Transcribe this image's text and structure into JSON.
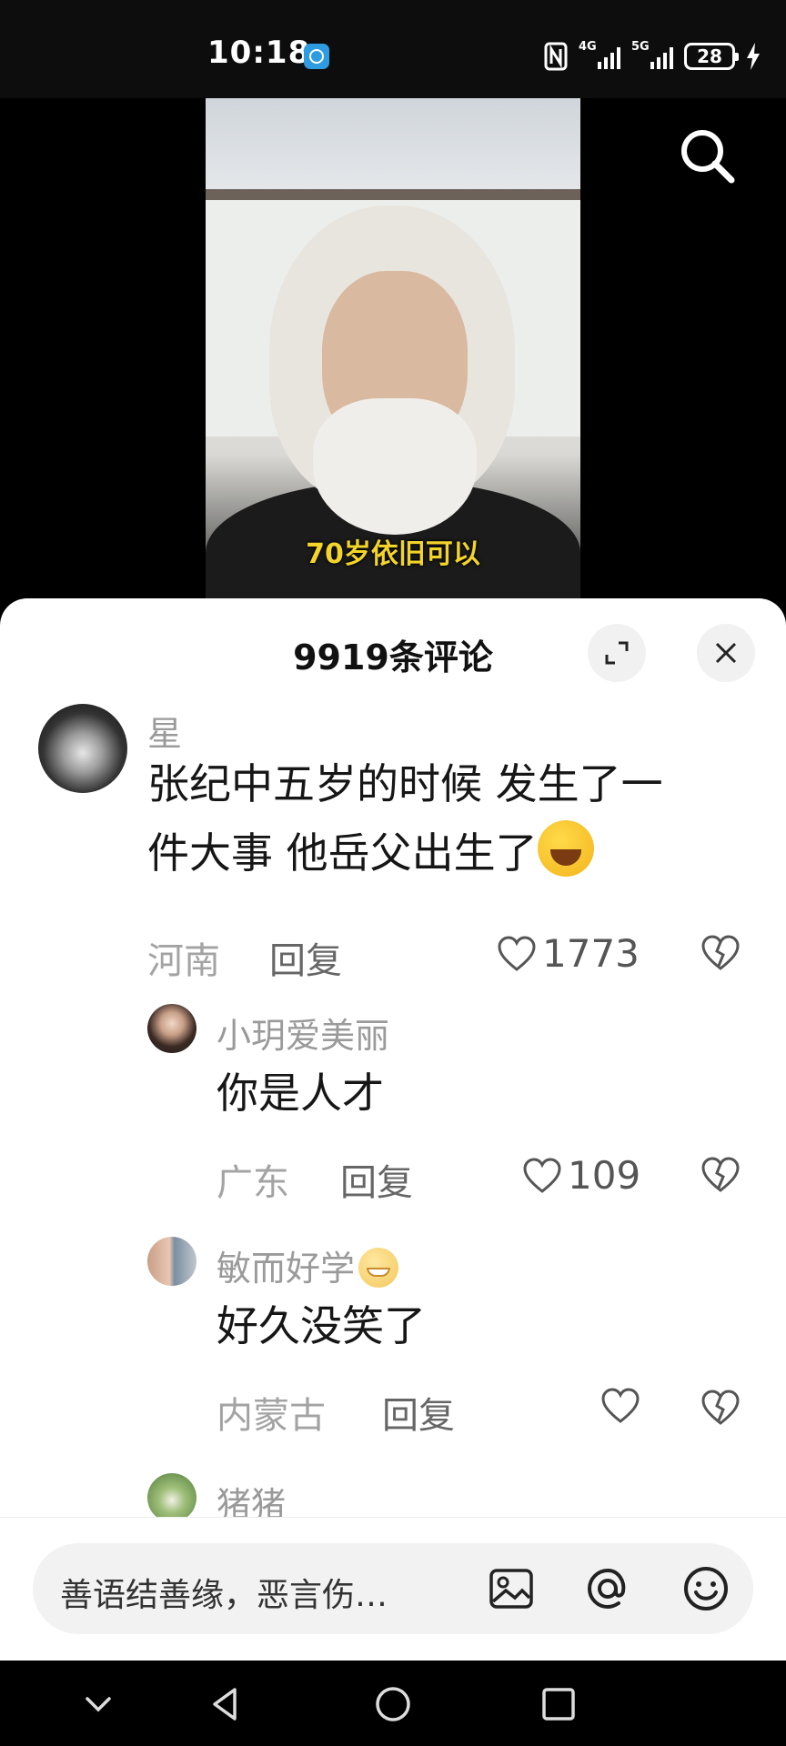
{
  "status_bar": {
    "time": "10:18",
    "network_1": "4G",
    "network_2": "5G",
    "battery": "28",
    "icons": [
      "globe-icon",
      "nfc-icon",
      "signal-4g-icon",
      "signal-5g-icon",
      "battery-icon",
      "charging-bolt-icon"
    ]
  },
  "video": {
    "caption": "70岁依旧可以",
    "search_icon": "search-icon"
  },
  "comments_panel": {
    "title": "9919条评论",
    "expand_icon": "expand-icon",
    "close_icon": "close-icon",
    "comments": [
      {
        "username": "星",
        "text_line1": "张纪中五岁的时候 发生了一",
        "text_line2": "件大事 他岳父出生了",
        "location": "河南",
        "reply_label": "回复",
        "likes": "1773"
      },
      {
        "username": "小玥爱美丽",
        "text": "你是人才",
        "location": "广东",
        "reply_label": "回复",
        "likes": "109"
      },
      {
        "username": "敏而好学",
        "text": "好久没笑了",
        "location": "内蒙古",
        "reply_label": "回复",
        "likes": ""
      },
      {
        "username": "猪猪"
      }
    ]
  },
  "input_bar": {
    "placeholder": "善语结善缘，恶言伤…",
    "icons": [
      "image-icon",
      "at-icon",
      "emoji-icon"
    ]
  },
  "nav_bar": {
    "icons": [
      "chevron-down-icon",
      "back-icon",
      "home-icon",
      "recents-icon"
    ]
  },
  "colors": {
    "sheet_bg": "#ffffff",
    "username": "#9a9a9a",
    "caption": "#f2d42a"
  }
}
